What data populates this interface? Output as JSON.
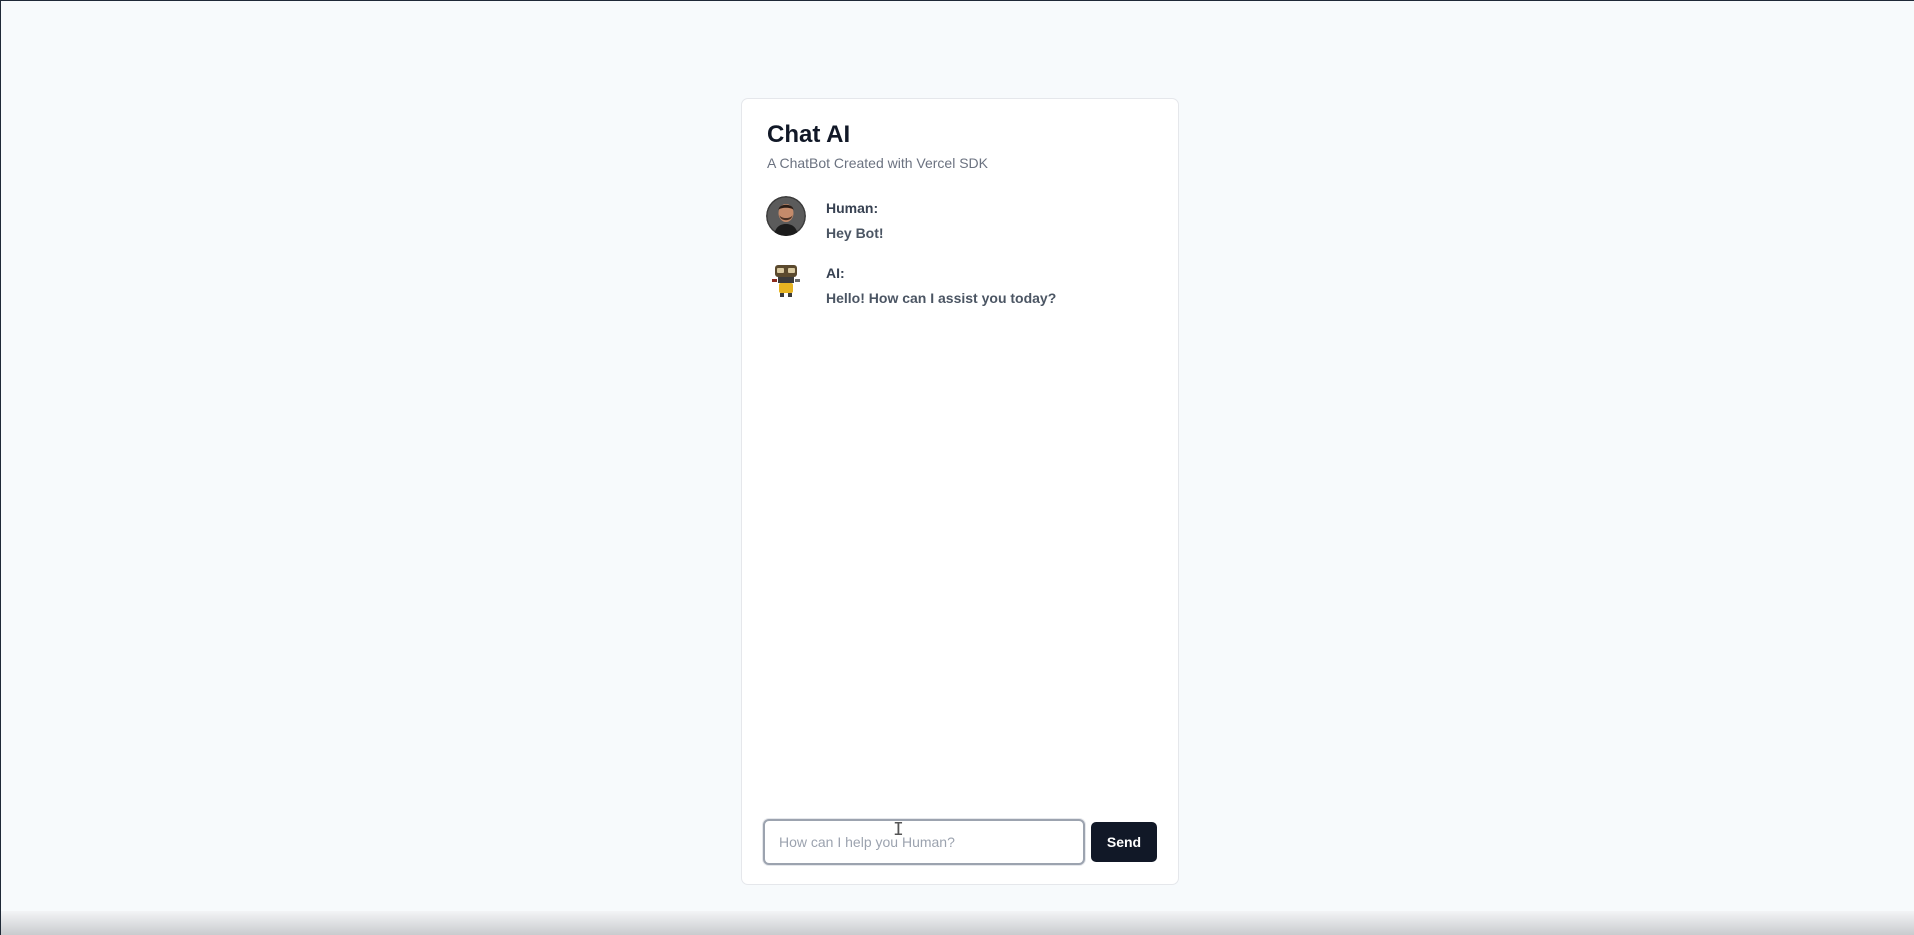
{
  "chat": {
    "title": "Chat AI",
    "subtitle": "A ChatBot Created with Vercel SDK",
    "messages": [
      {
        "sender": "Human:",
        "text": "Hey Bot!",
        "avatar": "human-avatar"
      },
      {
        "sender": "AI:",
        "text": "Hello! How can I assist you today?",
        "avatar": "bot-avatar"
      }
    ]
  },
  "composer": {
    "placeholder": "How can I help you Human?",
    "send_label": "Send"
  },
  "colors": {
    "background": "#f7fafc",
    "card": "#ffffff",
    "button": "#111827"
  }
}
